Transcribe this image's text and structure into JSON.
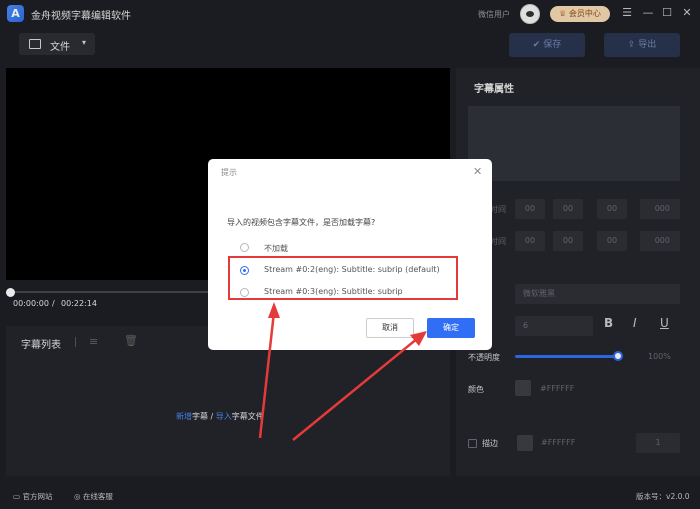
{
  "app": {
    "title": "金舟视频字幕编辑软件",
    "logo_letter": "A",
    "user_name": "微信用户",
    "vip_label": "会员中心",
    "window_controls": [
      "☰",
      "—",
      "☐",
      "✕"
    ]
  },
  "toolbar": {
    "file_label": "文件",
    "file_caret": "▾",
    "save_label": "保存",
    "export_label": "导出",
    "save_icon": "✔",
    "export_icon": "⇪"
  },
  "player": {
    "current_time": "00:00:00",
    "separator": "/",
    "total_time": "00:22:14"
  },
  "subtitle_list": {
    "title": "字幕列表",
    "tool_icons": [
      "≡",
      "🗑"
    ],
    "hint_new": "新增",
    "hint_word1": "字幕",
    "hint_sep": "/",
    "hint_import": "导入",
    "hint_word2": "字幕文件"
  },
  "props": {
    "title": "字幕属性",
    "start_label": "时间",
    "end_label": "时间",
    "time_h": "00",
    "time_m": "00",
    "time_s": "00",
    "time_ms": "000",
    "font_name": "微软雅黑",
    "font_size": "6",
    "bold": "B",
    "italic": "I",
    "underline": "U",
    "opacity_label": "不透明度",
    "opacity_value": "100%",
    "opacity_fraction": 1.0,
    "color_label": "颜色",
    "color_value": "#FFFFFF",
    "stroke_label": "描边",
    "stroke_color": "#FFFFFF",
    "stroke_width": "1"
  },
  "footer": {
    "website_label": "官方网站",
    "service_label": "在线客服",
    "version_label": "版本号：v2.0.0"
  },
  "dialog": {
    "title": "提示",
    "close_icon": "✕",
    "question": "导入的视频包含字幕文件，是否加载字幕?",
    "options": [
      {
        "label": "不加载",
        "checked": false
      },
      {
        "label": "Stream #0:2(eng): Subtitle: subrip (default)",
        "checked": true
      },
      {
        "label": "Stream #0:3(eng): Subtitle: subrip",
        "checked": false
      }
    ],
    "cancel_label": "取消",
    "ok_label": "确定"
  },
  "colors": {
    "accent": "#2f6ef5",
    "annotation_red": "#e53a3a",
    "background": "#1e1f24"
  }
}
